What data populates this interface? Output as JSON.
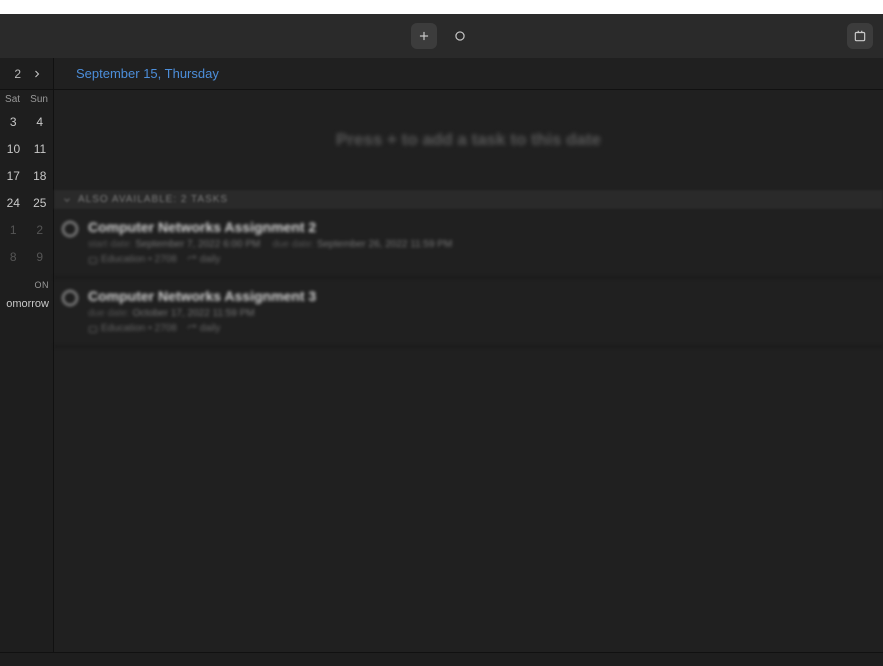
{
  "sidebar": {
    "nav_num": "2",
    "dow": [
      "Sat",
      "Sun"
    ],
    "rows": [
      [
        "3",
        "4"
      ],
      [
        "10",
        "11"
      ],
      [
        "17",
        "18"
      ],
      [
        "24",
        "25"
      ],
      [
        "1",
        "2"
      ],
      [
        "8",
        "9"
      ]
    ],
    "dim_rows": [
      4,
      5
    ],
    "section_label": "ON",
    "quick_item": "omorrow"
  },
  "main": {
    "date_title": "September 15, Thursday",
    "empty_hint": "Press + to add a task to this date",
    "section_header": "ALSO AVAILABLE: 2 TASKS",
    "tasks": [
      {
        "title": "Computer Networks Assignment 2",
        "start_label": "start date:",
        "start_value": "September 7, 2022 6:00 PM",
        "due_label": "due date:",
        "due_value": "September 26, 2022 11:59 PM",
        "folder": "Education • 2708",
        "repeat": "daily"
      },
      {
        "title": "Computer Networks Assignment 3",
        "start_label": "due date:",
        "start_value": "October 17, 2022 11:59 PM",
        "due_label": "",
        "due_value": "",
        "folder": "Education • 2708",
        "repeat": "daily"
      }
    ]
  }
}
